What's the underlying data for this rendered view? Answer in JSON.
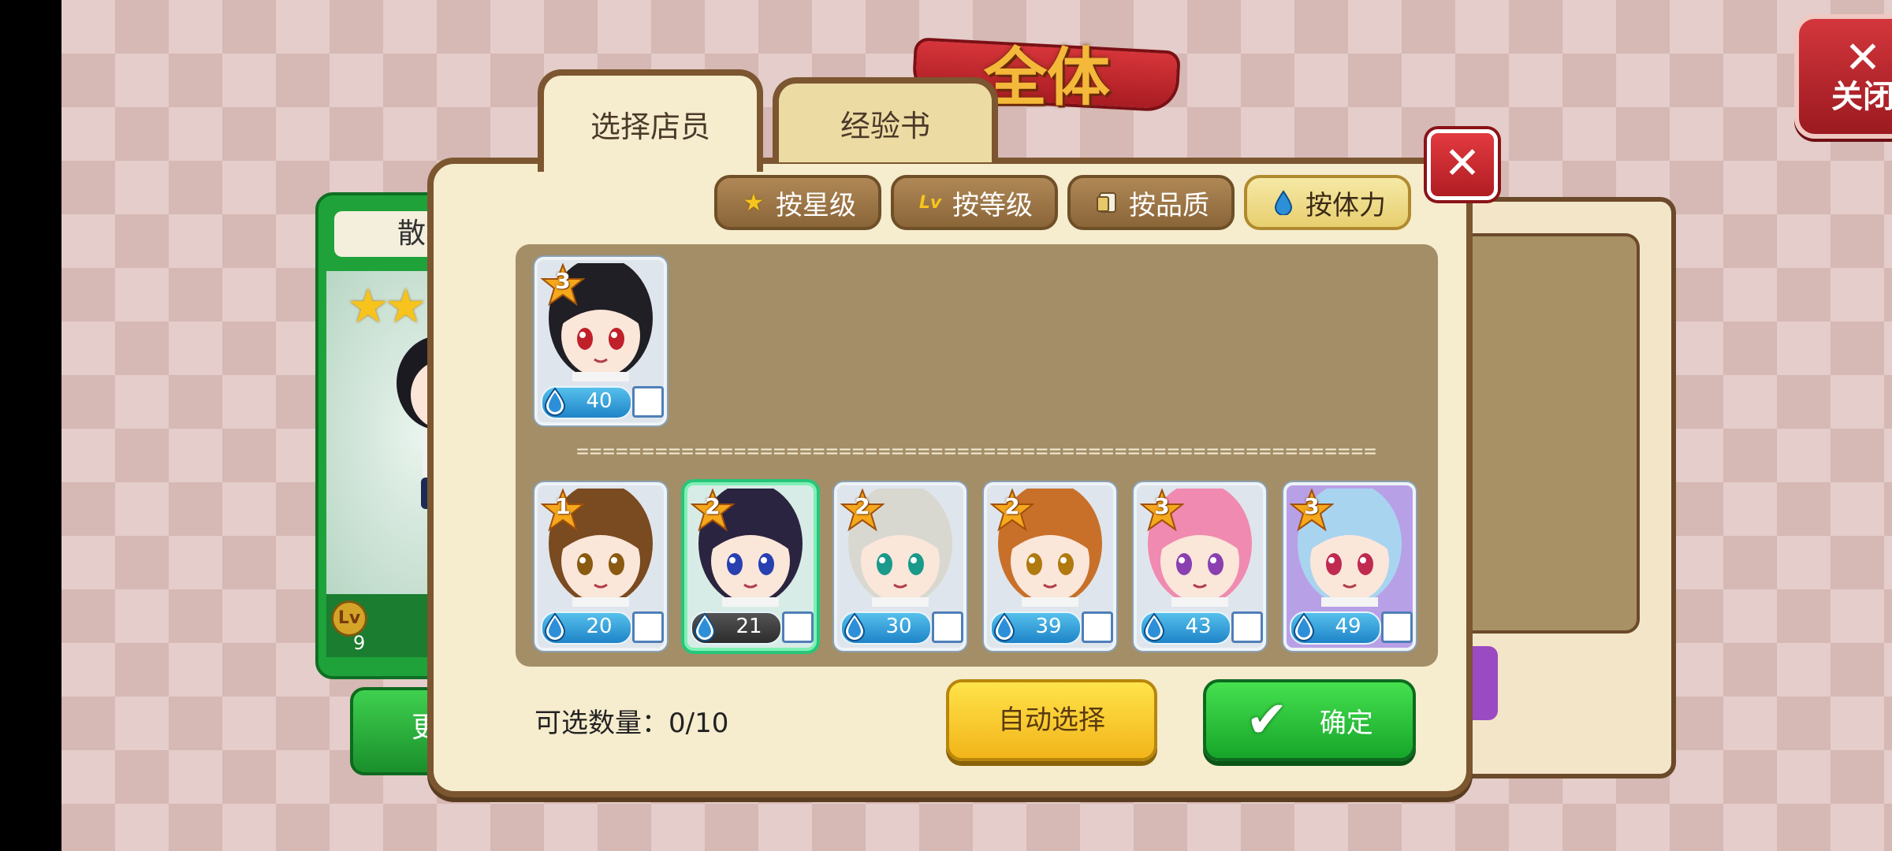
{
  "banner": {
    "title": "全体"
  },
  "top_close": {
    "label": "关闭",
    "icon": "close-icon"
  },
  "background_card": {
    "name": "散华礼",
    "stars": 2,
    "level": "9",
    "change_label": "更换"
  },
  "tabs": [
    {
      "label": "选择店员",
      "active": true
    },
    {
      "label": "经验书",
      "active": false
    }
  ],
  "sort_buttons": [
    {
      "label": "按星级",
      "icon": "star-icon",
      "active": false
    },
    {
      "label": "按等级",
      "icon": "lv-icon",
      "active": false
    },
    {
      "label": "按品质",
      "icon": "quality-card-icon",
      "active": false
    },
    {
      "label": "按体力",
      "icon": "water-drop-icon",
      "active": true
    }
  ],
  "divider": "=============================================================",
  "top_row": [
    {
      "stars": "3",
      "stamina": "40",
      "selected": false,
      "hair": "#1f1f25",
      "eyes": "#c0202a",
      "bg": "#dfe5ec"
    }
  ],
  "bottom_row": [
    {
      "stars": "1",
      "stamina": "20",
      "selected": false,
      "hair": "#7a4a20",
      "eyes": "#8a5a10",
      "bg": "#dfe5ec"
    },
    {
      "stars": "2",
      "stamina": "21",
      "selected": true,
      "hair": "#2b2440",
      "eyes": "#2840b0",
      "bg": "#d7ece6"
    },
    {
      "stars": "2",
      "stamina": "30",
      "selected": false,
      "hair": "#d8d8d0",
      "eyes": "#1a9a8a",
      "bg": "#dfe5ec"
    },
    {
      "stars": "2",
      "stamina": "39",
      "selected": false,
      "hair": "#c8702a",
      "eyes": "#b07a10",
      "bg": "#dfe5ec"
    },
    {
      "stars": "3",
      "stamina": "43",
      "selected": false,
      "hair": "#f08ab0",
      "eyes": "#8a40b0",
      "bg": "#dfe5ec"
    },
    {
      "stars": "3",
      "stamina": "49",
      "selected": false,
      "hair": "#a8d4f0",
      "eyes": "#c02a50",
      "bg": "#b8a0e6"
    }
  ],
  "count": {
    "label": "可选数量：0/10"
  },
  "auto_select": {
    "label": "自动选择"
  },
  "confirm": {
    "label": "确定"
  },
  "colors": {
    "accent_green": "#1fa23a",
    "panel": "#f6ecce",
    "grid_bg": "#a38e67",
    "stamina_blue": "#1e84c8"
  }
}
